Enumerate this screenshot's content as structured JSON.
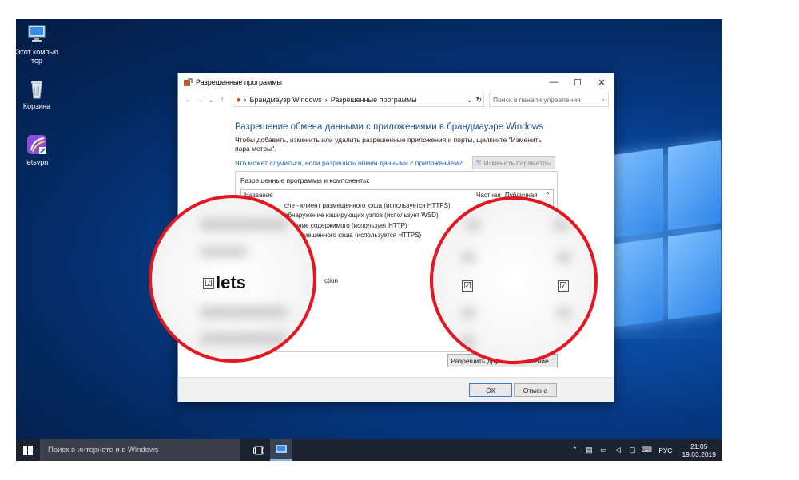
{
  "desktop": {
    "icons": [
      {
        "label": "Этот компью тер"
      },
      {
        "label": "Корзина"
      },
      {
        "label": "letsvpn"
      }
    ]
  },
  "dialog": {
    "title": "Разрешенные программы",
    "breadcrumb": [
      "Брандмауэр Windows",
      "Разрешенные программы"
    ],
    "search_placeholder": "Поиск в панели управления",
    "heading": "Разрешение обмена данными с приложениями в брандмауэре Windows",
    "description": "Чтобы добавить, изменить или удалить разрешенные приложения и порты, щелкните \"Изменить пара метры\".",
    "risk_link": "Что может случиться, если разрешить обмен данными с приложением?",
    "change_settings": "Изменить параметры",
    "group_label": "Разрешенные программы и компоненты:",
    "columns": {
      "name": "Название",
      "private": "Частная",
      "public": "Публичная"
    },
    "rows": [
      {
        "name": "che - клиент размещенного кэша (используется HTTPS)"
      },
      {
        "name": "обнаружение кэширующих узлов (использует WSD)"
      },
      {
        "name": "лучение содержимого (использует HTTP)"
      },
      {
        "name": "ер размещенного кэша (используется HTTPS)"
      },
      {
        "name": "ction"
      }
    ],
    "allow_another": "Разрешить другое приложение...",
    "ok": "ОК",
    "cancel": "Отмена"
  },
  "magnifier": {
    "left_text": "lets",
    "check": "☑"
  },
  "taskbar": {
    "search_placeholder": "Поиск в интернете и в Windows",
    "language": "РУС",
    "time": "21:05",
    "date": "19.03.2019"
  }
}
